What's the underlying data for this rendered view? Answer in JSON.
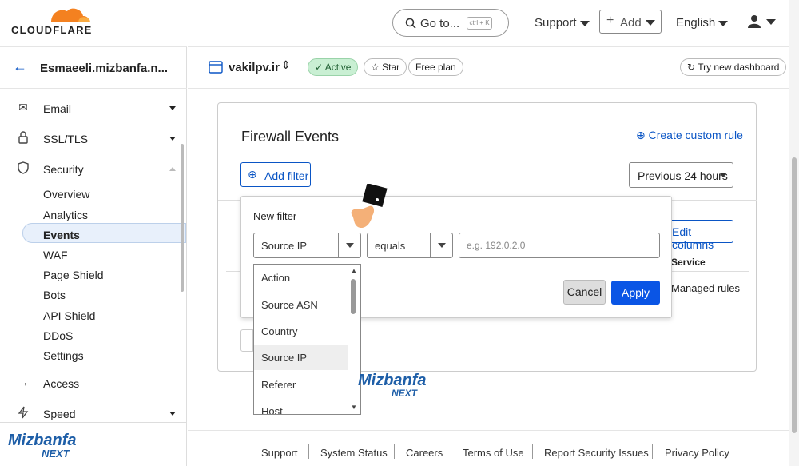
{
  "brand": {
    "logo_text": "CLOUDFLARE",
    "orange": "#f48120"
  },
  "topbar": {
    "search_label": "Go to...",
    "search_shortcut": "ctrl + K",
    "support": "Support",
    "add": "Add",
    "language": "English"
  },
  "sidebar": {
    "account": "Esmaeeli.mizbanfa.n...",
    "items": [
      {
        "label": "Email",
        "icon": "email-icon"
      },
      {
        "label": "SSL/TLS",
        "icon": "lock-icon"
      },
      {
        "label": "Security",
        "icon": "shield-icon"
      }
    ],
    "security_sub": [
      "Overview",
      "Analytics",
      "Events",
      "WAF",
      "Page Shield",
      "Bots",
      "API Shield",
      "DDoS",
      "Settings"
    ],
    "items_after": [
      {
        "label": "Access",
        "icon": "access-icon"
      },
      {
        "label": "Speed",
        "icon": "speed-icon"
      }
    ]
  },
  "zone": {
    "domain": "vakilpv.ir",
    "status": "Active",
    "star": "Star",
    "plan": "Free plan",
    "try_new": "Try new dashboard"
  },
  "firewall": {
    "title": "Firewall Events",
    "create_rule": "Create custom rule",
    "add_filter": "Add filter",
    "time_range": "Previous 24 hours",
    "edit_columns": "Edit columns",
    "col_service": "Service",
    "cell_service": "Managed rules"
  },
  "filter_popover": {
    "title": "New filter",
    "field_value": "Source IP",
    "operator_value": "equals",
    "value_placeholder": "e.g. 192.0.2.0",
    "cancel": "Cancel",
    "apply": "Apply",
    "options": [
      "Action",
      "Source ASN",
      "Country",
      "Source IP",
      "Referer",
      "Host"
    ],
    "highlighted_option": "Source IP"
  },
  "watermark": {
    "line1": "Mizbanfa",
    "line2": "NEXT"
  },
  "footer": [
    "Support",
    "System Status",
    "Careers",
    "Terms of Use",
    "Report Security Issues",
    "Privacy Policy"
  ]
}
